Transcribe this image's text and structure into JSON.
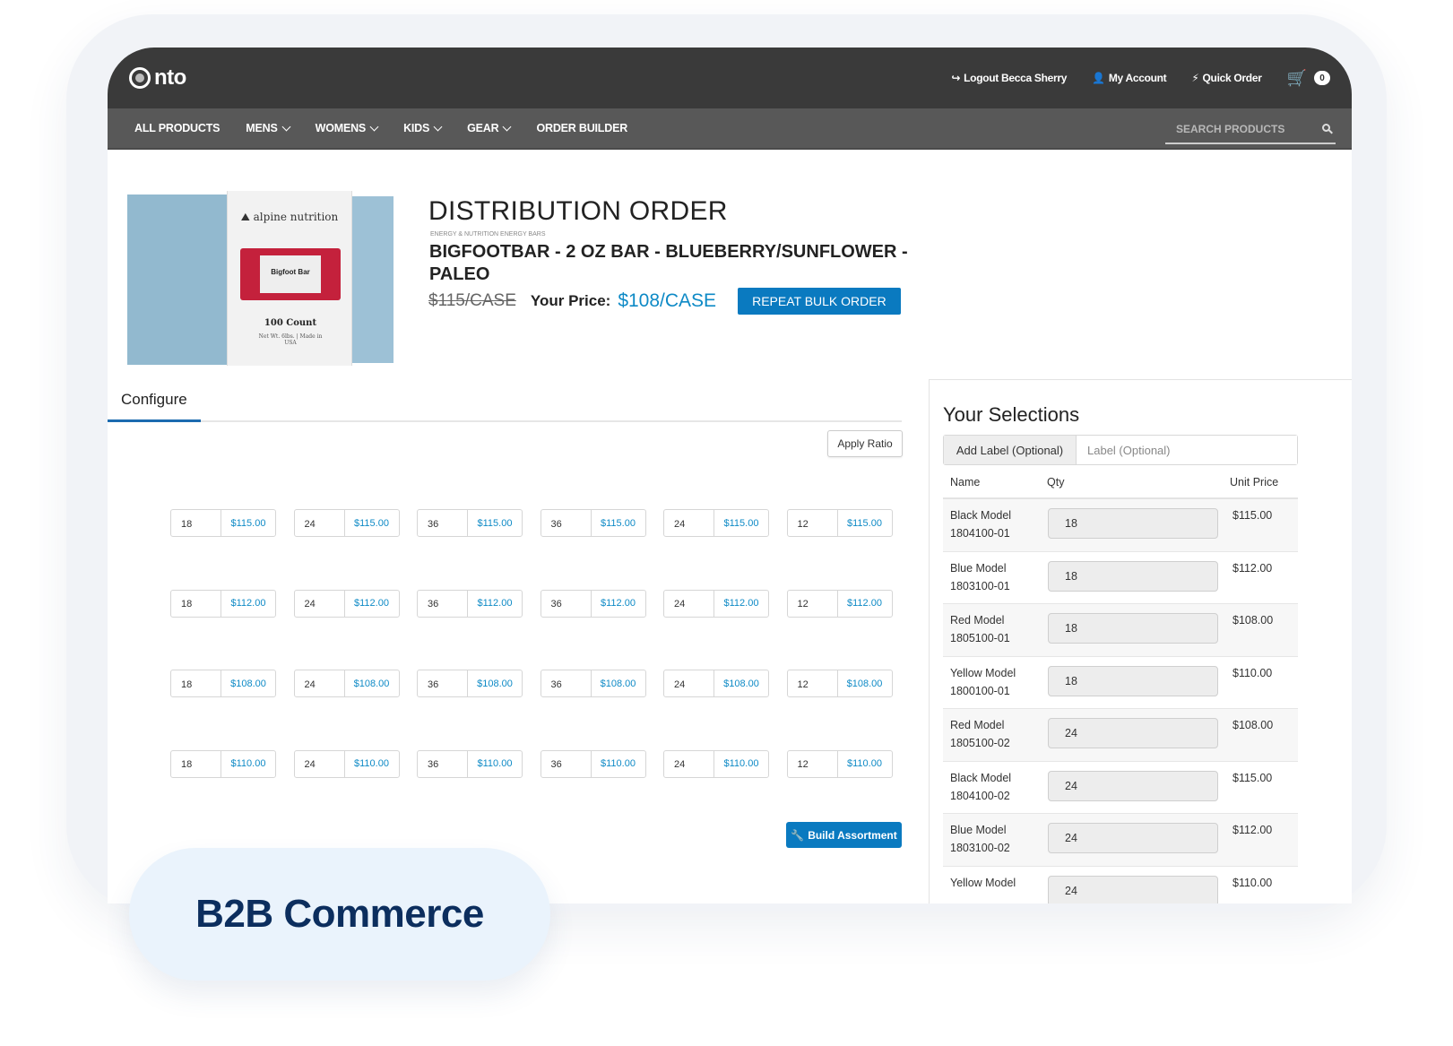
{
  "header": {
    "logo_text": "nto",
    "links": [
      {
        "icon": "logout-icon",
        "glyph": "↪",
        "label": "Logout Becca Sherry"
      },
      {
        "icon": "user-icon",
        "glyph": "👤",
        "label": "My Account"
      },
      {
        "icon": "lightning-icon",
        "glyph": "⚡",
        "label": "Quick Order"
      }
    ],
    "cart_count": "0"
  },
  "nav": {
    "items": [
      {
        "label": "ALL PRODUCTS",
        "dropdown": false
      },
      {
        "label": "MENS",
        "dropdown": true
      },
      {
        "label": "WOMENS",
        "dropdown": true
      },
      {
        "label": "KIDS",
        "dropdown": true
      },
      {
        "label": "GEAR",
        "dropdown": true
      },
      {
        "label": "ORDER BUILDER",
        "dropdown": false
      }
    ],
    "search_placeholder": "SEARCH PRODUCTS"
  },
  "product": {
    "image": {
      "brand": "alpine nutrition",
      "bar_name": "Bigfoot Bar",
      "count": "100 Count",
      "net_weight": "Net Wt. 6lbs. | Made in USA"
    },
    "page_title": "DISTRIBUTION ORDER",
    "category": "ENERGY & NUTRITION ENERGY BARS",
    "name": "BIGFOOTBAR - 2 OZ BAR - BLUEBERRY/SUNFLOWER - PALEO",
    "original_price": "$115/CASE",
    "your_price_label": "Your Price:",
    "your_price": "$108/CASE",
    "repeat_button": "REPEAT BULK ORDER"
  },
  "configure": {
    "tab_label": "Configure",
    "apply_ratio_button": "Apply Ratio",
    "grid": [
      [
        {
          "qty": "18",
          "price": "$115.00"
        },
        {
          "qty": "24",
          "price": "$115.00"
        },
        {
          "qty": "36",
          "price": "$115.00"
        },
        {
          "qty": "36",
          "price": "$115.00"
        },
        {
          "qty": "24",
          "price": "$115.00"
        },
        {
          "qty": "12",
          "price": "$115.00"
        }
      ],
      [
        {
          "qty": "18",
          "price": "$112.00"
        },
        {
          "qty": "24",
          "price": "$112.00"
        },
        {
          "qty": "36",
          "price": "$112.00"
        },
        {
          "qty": "36",
          "price": "$112.00"
        },
        {
          "qty": "24",
          "price": "$112.00"
        },
        {
          "qty": "12",
          "price": "$112.00"
        }
      ],
      [
        {
          "qty": "18",
          "price": "$108.00"
        },
        {
          "qty": "24",
          "price": "$108.00"
        },
        {
          "qty": "36",
          "price": "$108.00"
        },
        {
          "qty": "36",
          "price": "$108.00"
        },
        {
          "qty": "24",
          "price": "$108.00"
        },
        {
          "qty": "12",
          "price": "$108.00"
        }
      ],
      [
        {
          "qty": "18",
          "price": "$110.00"
        },
        {
          "qty": "24",
          "price": "$110.00"
        },
        {
          "qty": "36",
          "price": "$110.00"
        },
        {
          "qty": "36",
          "price": "$110.00"
        },
        {
          "qty": "24",
          "price": "$110.00"
        },
        {
          "qty": "12",
          "price": "$110.00"
        }
      ]
    ],
    "build_button": "Build Assortment"
  },
  "selections": {
    "title": "Your Selections",
    "add_label": "Add Label (Optional)",
    "label_placeholder": "Label (Optional)",
    "columns": [
      "Name",
      "Qty",
      "Unit Price"
    ],
    "rows": [
      {
        "name": "Black Model",
        "sku": "1804100-01",
        "qty": "18",
        "price": "$115.00"
      },
      {
        "name": "Blue Model",
        "sku": "1803100-01",
        "qty": "18",
        "price": "$112.00"
      },
      {
        "name": "Red Model",
        "sku": "1805100-01",
        "qty": "18",
        "price": "$108.00"
      },
      {
        "name": "Yellow Model",
        "sku": "1800100-01",
        "qty": "18",
        "price": "$110.00"
      },
      {
        "name": "Red Model",
        "sku": "1805100-02",
        "qty": "24",
        "price": "$108.00"
      },
      {
        "name": "Black Model",
        "sku": "1804100-02",
        "qty": "24",
        "price": "$115.00"
      },
      {
        "name": "Blue Model",
        "sku": "1803100-02",
        "qty": "24",
        "price": "$112.00"
      },
      {
        "name": "Yellow Model",
        "sku": "",
        "qty": "24",
        "price": "$110.00"
      }
    ]
  },
  "badge": {
    "text": "B2B Commerce"
  },
  "colors": {
    "accent": "#0a7ac0",
    "price_blue": "#0e8ac6",
    "topbar": "#3a3a3a",
    "navbar": "#585858",
    "badge_text": "#0c2e5e"
  }
}
